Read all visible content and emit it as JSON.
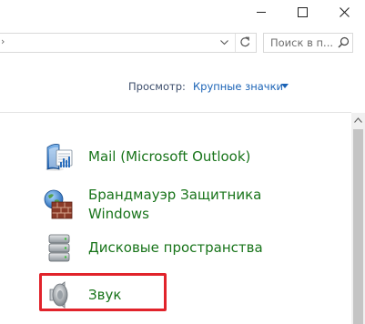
{
  "window": {
    "controls": [
      "minimize",
      "maximize",
      "close"
    ]
  },
  "address_bar": {
    "left_glyph": "›",
    "dropdown_icon": "chevron-down-icon",
    "refresh_icon": "refresh-icon"
  },
  "search": {
    "placeholder": "Поиск в п..."
  },
  "view_by": {
    "label": "Просмотр:",
    "value": "Крупные значки"
  },
  "items": [
    {
      "label": "Mail (Microsoft Outlook)",
      "icon": "mail-outlook-icon"
    },
    {
      "label_line1": "Брандмауэр Защитника",
      "label_line2": "Windows",
      "icon": "firewall-icon"
    },
    {
      "label": "Дисковые пространства",
      "icon": "storage-spaces-icon"
    },
    {
      "label": "Звук",
      "icon": "speaker-icon"
    }
  ],
  "colors": {
    "link_green": "#18741a",
    "link_blue": "#1b63b6",
    "highlight_red": "#e1232b"
  }
}
